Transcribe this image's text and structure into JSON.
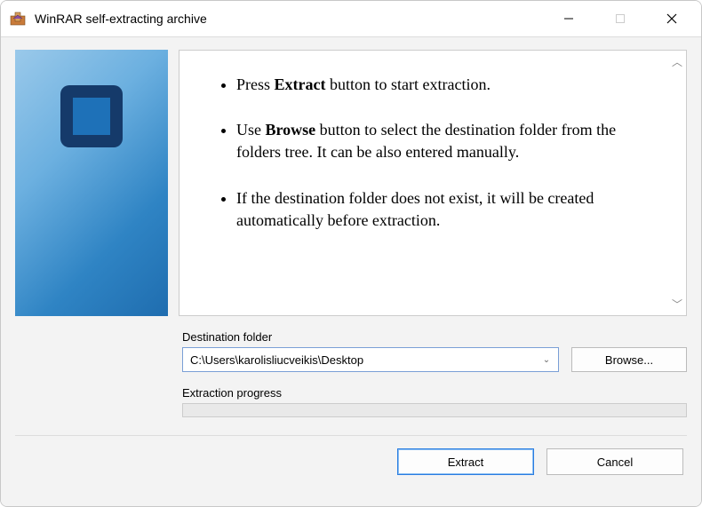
{
  "window": {
    "title": "WinRAR self-extracting archive"
  },
  "instructions": {
    "item1_pre": "Press ",
    "item1_strong": "Extract",
    "item1_post": " button to start extraction.",
    "item2_pre": "Use ",
    "item2_strong": "Browse",
    "item2_post": " button to select the destination folder from the folders tree. It can be also entered manually.",
    "item3": "If the destination folder does not exist, it will be created automatically before extraction."
  },
  "form": {
    "dest_label": "Destination folder",
    "dest_value": "C:\\Users\\karolisliucveikis\\Desktop",
    "browse_label": "Browse...",
    "progress_label": "Extraction progress"
  },
  "buttons": {
    "extract": "Extract",
    "cancel": "Cancel"
  }
}
